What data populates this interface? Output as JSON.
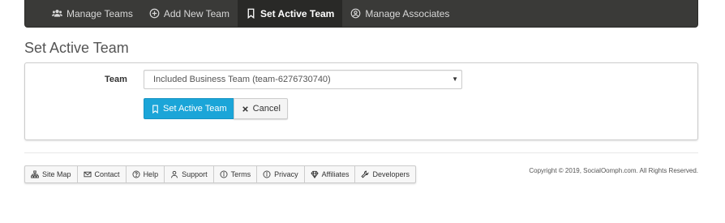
{
  "nav": {
    "items": [
      {
        "label": "Manage Teams",
        "icon": "users-icon",
        "active": false
      },
      {
        "label": "Add New Team",
        "icon": "plus-circle-icon",
        "active": false
      },
      {
        "label": "Set Active Team",
        "icon": "bookmark-icon",
        "active": true
      },
      {
        "label": "Manage Associates",
        "icon": "user-circle-icon",
        "active": false
      }
    ]
  },
  "page": {
    "title": "Set Active Team"
  },
  "form": {
    "team_label": "Team",
    "team_select_value": "Included Business Team (team-6276730740)",
    "submit_label": "Set Active Team",
    "cancel_label": "Cancel"
  },
  "footer": {
    "links": [
      {
        "label": "Site Map",
        "icon": "sitemap-icon"
      },
      {
        "label": "Contact",
        "icon": "envelope-icon"
      },
      {
        "label": "Help",
        "icon": "question-circle-icon"
      },
      {
        "label": "Support",
        "icon": "user-icon"
      },
      {
        "label": "Terms",
        "icon": "info-circle-icon"
      },
      {
        "label": "Privacy",
        "icon": "info-circle-icon"
      },
      {
        "label": "Affiliates",
        "icon": "diamond-icon"
      },
      {
        "label": "Developers",
        "icon": "wrench-icon"
      }
    ],
    "copyright": "Copyright © 2019, SocialOomph.com. All Rights Reserved."
  },
  "colors": {
    "nav_bg": "#3a3a38",
    "primary": "#1ba5d8"
  }
}
